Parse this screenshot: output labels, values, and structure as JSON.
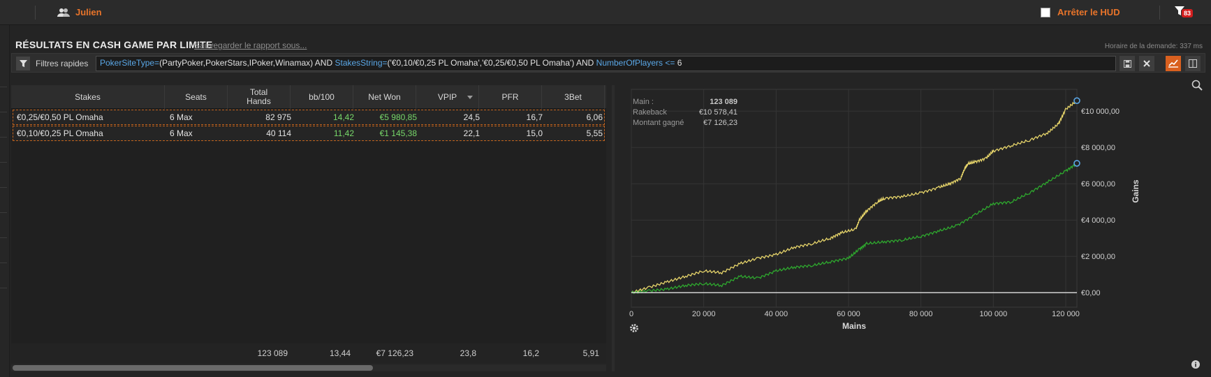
{
  "topbar": {
    "user_name": "Julien",
    "hud_label": "Arrêter le HUD",
    "notification_count": "83"
  },
  "report": {
    "title": "RÉSULTATS EN CASH GAME PAR LIMITE",
    "save_link": "Sauvegarder le rapport sous...",
    "timing": "Horaire de la demande: 337 ms"
  },
  "filter": {
    "label": "Filtres rapides",
    "query_parts": [
      {
        "text": "PokerSiteType=",
        "kw": true
      },
      {
        "text": "(PartyPoker,PokerStars,IPoker,Winamax) AND ",
        "kw": false
      },
      {
        "text": "StakesString=",
        "kw": true
      },
      {
        "text": "('€0,10/€0,25 PL Omaha','€0,25/€0,50 PL Omaha') AND ",
        "kw": false
      },
      {
        "text": "NumberOfPlayers <=",
        "kw": true
      },
      {
        "text": " 6",
        "kw": false
      }
    ]
  },
  "table": {
    "columns": [
      "Stakes",
      "Seats",
      "Total Hands",
      "bb/100",
      "Net Won",
      "VPIP",
      "PFR",
      "3Bet"
    ],
    "rows": [
      [
        "€0,25/€0,50 PL Omaha",
        "6 Max",
        "82 975",
        "14,42",
        "€5 980,85",
        "24,5",
        "16,7",
        "6,06"
      ],
      [
        "€0,10/€0,25 PL Omaha",
        "6 Max",
        "40 114",
        "11,42",
        "€1 145,38",
        "22,1",
        "15,0",
        "5,55"
      ]
    ],
    "totals": [
      "",
      "",
      "123 089",
      "13,44",
      "€7 126,23",
      "23,8",
      "16,2",
      "5,91"
    ]
  },
  "chart_legend": [
    {
      "label": "Main :",
      "value": "123 089"
    },
    {
      "label": "Rakeback",
      "value": "€10 578,41"
    },
    {
      "label": "Montant gagné",
      "value": "€7 126,23"
    }
  ],
  "chart_data": {
    "type": "line",
    "title": "",
    "xlabel": "Mains",
    "ylabel": "Gains",
    "xlim": [
      0,
      123089
    ],
    "ylim": [
      -800,
      11200
    ],
    "x_ticks": [
      "0",
      "20 000",
      "40 000",
      "60 000",
      "80 000",
      "100 000",
      "120 000"
    ],
    "y_ticks": [
      "€0,00",
      "€2 000,00",
      "€4 000,00",
      "€6 000,00",
      "€8 000,00",
      "€10 000,00"
    ],
    "grid": true,
    "series": [
      {
        "color": "#e6d46a",
        "x": [
          0,
          5000,
          10000,
          15000,
          20000,
          25000,
          30000,
          35000,
          40000,
          45000,
          50000,
          55000,
          58000,
          62000,
          63000,
          65000,
          68000,
          70000,
          75000,
          80000,
          85000,
          88000,
          91000,
          92000,
          93000,
          95000,
          98000,
          100000,
          105000,
          110000,
          115000,
          118000,
          120000,
          123089
        ],
        "y": [
          0,
          300,
          600,
          900,
          1200,
          1100,
          1600,
          1900,
          2100,
          2500,
          2700,
          3000,
          3300,
          3500,
          4000,
          4500,
          5000,
          5200,
          5300,
          5500,
          5800,
          6000,
          6300,
          6800,
          7100,
          7200,
          7400,
          7800,
          8100,
          8400,
          8800,
          9300,
          10100,
          10578
        ]
      },
      {
        "color": "#2ea82e",
        "x": [
          0,
          5000,
          10000,
          15000,
          20000,
          25000,
          30000,
          35000,
          40000,
          45000,
          50000,
          55000,
          60000,
          63000,
          65000,
          70000,
          75000,
          80000,
          85000,
          90000,
          95000,
          100000,
          105000,
          110000,
          115000,
          120000,
          123089
        ],
        "y": [
          0,
          100,
          200,
          400,
          500,
          400,
          900,
          800,
          1200,
          1400,
          1500,
          1700,
          1900,
          2400,
          2700,
          2800,
          2900,
          3100,
          3400,
          3700,
          4300,
          4900,
          5000,
          5500,
          6100,
          6700,
          7126
        ]
      },
      {
        "color": "#e0e0e0",
        "x": [
          0,
          123089
        ],
        "y": [
          0,
          0
        ]
      }
    ]
  }
}
